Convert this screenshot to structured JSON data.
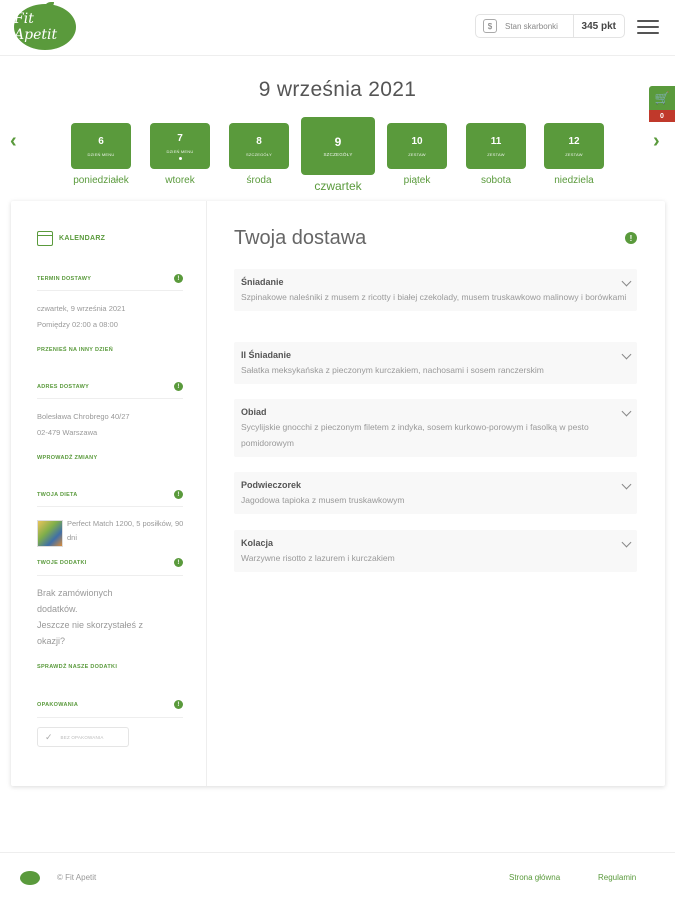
{
  "header": {
    "logo_text": "Fit Apetit",
    "piggy_label": "Stan skarbonki",
    "piggy_value": "345 pkt"
  },
  "cart": {
    "count": "0"
  },
  "date_title": "9 września 2021",
  "days": [
    {
      "num": "6",
      "tag": "DZIEŃ MENU",
      "name": "poniedziałek",
      "dot": false,
      "active": false
    },
    {
      "num": "7",
      "tag": "DZIEŃ MENU",
      "name": "wtorek",
      "dot": true,
      "active": false
    },
    {
      "num": "8",
      "tag": "SZCZEGÓŁY",
      "name": "środa",
      "dot": false,
      "active": false
    },
    {
      "num": "9",
      "tag": "SZCZEGÓŁY",
      "name": "czwartek",
      "dot": false,
      "active": true
    },
    {
      "num": "10",
      "tag": "ZESTAW",
      "name": "piątek",
      "dot": false,
      "active": false
    },
    {
      "num": "11",
      "tag": "ZESTAW",
      "name": "sobota",
      "dot": false,
      "active": false
    },
    {
      "num": "12",
      "tag": "ZESTAW",
      "name": "niedziela",
      "dot": false,
      "active": false
    }
  ],
  "sidebar": {
    "calendar_label": "KALENDARZ",
    "delivery_term": {
      "heading": "TERMIN DOSTAWY",
      "line1": "czwartek, 9 września 2021",
      "line2": "Pomiędzy 02:00 a 08:00",
      "link": "PRZENIEŚ NA INNY DZIEŃ"
    },
    "address": {
      "heading": "ADRES DOSTAWY",
      "line1": "Bolesława Chrobrego 40/27",
      "line2": "02-479 Warszawa",
      "link": "WPROWADŹ ZMIANY"
    },
    "diet": {
      "heading": "TWOJA DIETA",
      "text": "Perfect Match 1200, 5 posiłków, 90 dni"
    },
    "addons": {
      "heading": "TWOJE DODATKI",
      "line1": "Brak zamówionych",
      "line2": "dodatków.",
      "line3": "Jeszcze nie skorzystałeś z",
      "line4": "okazji?",
      "link": "SPRAWDŹ NASZE DODATKI"
    },
    "packaging": {
      "heading": "OPAKOWANIA",
      "button": "BEZ OPAKOWANIA"
    }
  },
  "content": {
    "title": "Twoja dostawa",
    "meals": [
      {
        "name": "Śniadanie",
        "desc": "Szpinakowe naleśniki z musem z ricotty i białej czekolady, musem truskawkowo malinowy i borówkami"
      },
      {
        "name": "II Śniadanie",
        "desc": "Sałatka meksykańska z pieczonym kurczakiem, nachosami i sosem ranczerskim"
      },
      {
        "name": "Obiad",
        "desc": "Sycylijskie gnocchi z pieczonym filetem z indyka, sosem kurkowo-porowym i fasolką w pesto pomidorowym"
      },
      {
        "name": "Podwieczorek",
        "desc": "Jagodowa tapioka z musem truskawkowym"
      },
      {
        "name": "Kolacja",
        "desc": "Warzywne risotto z lazurem i kurczakiem"
      }
    ]
  },
  "footer": {
    "copyright": "© Fit Apetit",
    "link_home": "Strona główna",
    "link_terms": "Regulamin"
  }
}
